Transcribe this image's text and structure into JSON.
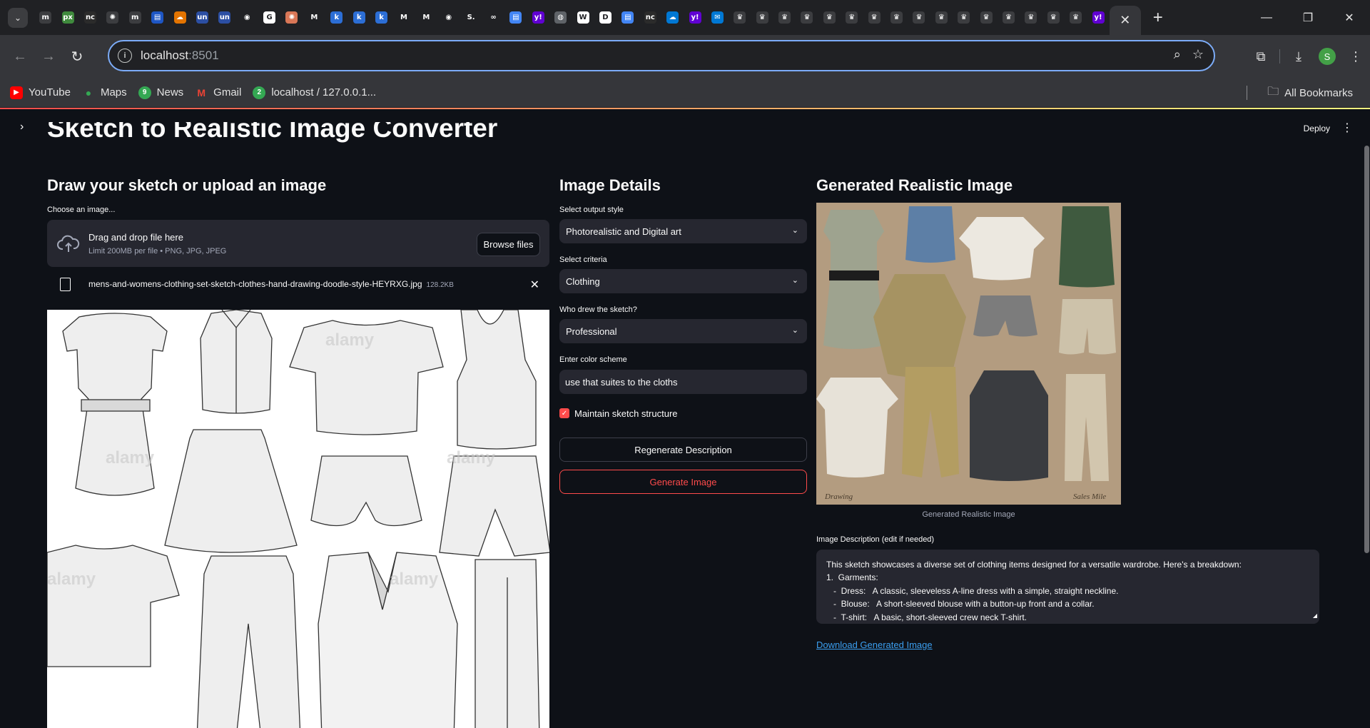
{
  "browser": {
    "active_tab_close": "✕",
    "new_tab": "+",
    "url_host": "localhost",
    "url_port": ":8501",
    "favicons": [
      {
        "t": "m",
        "bg": "#3c3d40"
      },
      {
        "t": "px",
        "bg": "#3f8a3d"
      },
      {
        "t": "nc",
        "bg": "#2b2b2b"
      },
      {
        "t": "✺",
        "bg": "#3c3d40"
      },
      {
        "t": "m",
        "bg": "#3c3d40"
      },
      {
        "t": "▤",
        "bg": "#1e56c4"
      },
      {
        "t": "☁",
        "bg": "#e37400"
      },
      {
        "t": "un",
        "bg": "#2c4fa3"
      },
      {
        "t": "un",
        "bg": "#2c4fa3"
      },
      {
        "t": "◉",
        "bg": "#202124"
      },
      {
        "t": "G",
        "bg": "#ffffff"
      },
      {
        "t": "✺",
        "bg": "#d97757"
      },
      {
        "t": "M",
        "bg": "#202124"
      },
      {
        "t": "k",
        "bg": "#2c6ed5"
      },
      {
        "t": "k",
        "bg": "#2c6ed5"
      },
      {
        "t": "k",
        "bg": "#2c6ed5"
      },
      {
        "t": "M",
        "bg": "#202124"
      },
      {
        "t": "M",
        "bg": "#202124"
      },
      {
        "t": "◉",
        "bg": "#202124"
      },
      {
        "t": "S.",
        "bg": "#202124"
      },
      {
        "t": "∞",
        "bg": "#202124"
      },
      {
        "t": "▤",
        "bg": "#4285f4"
      },
      {
        "t": "y!",
        "bg": "#6001d2"
      },
      {
        "t": "◍",
        "bg": "#5f6368"
      },
      {
        "t": "W",
        "bg": "#ffffff"
      },
      {
        "t": "D",
        "bg": "#ffffff"
      },
      {
        "t": "▤",
        "bg": "#4285f4"
      },
      {
        "t": "nc",
        "bg": "#2b2b2b"
      },
      {
        "t": "☁",
        "bg": "#0078d4"
      },
      {
        "t": "y!",
        "bg": "#6001d2"
      },
      {
        "t": "✉",
        "bg": "#0078d4"
      },
      {
        "t": "♛",
        "bg": "#3c3d40"
      },
      {
        "t": "♛",
        "bg": "#3c3d40"
      },
      {
        "t": "♛",
        "bg": "#3c3d40"
      },
      {
        "t": "♛",
        "bg": "#3c3d40"
      },
      {
        "t": "♛",
        "bg": "#3c3d40"
      },
      {
        "t": "♛",
        "bg": "#3c3d40"
      },
      {
        "t": "♛",
        "bg": "#3c3d40"
      },
      {
        "t": "♛",
        "bg": "#3c3d40"
      },
      {
        "t": "♛",
        "bg": "#3c3d40"
      },
      {
        "t": "♛",
        "bg": "#3c3d40"
      },
      {
        "t": "♛",
        "bg": "#3c3d40"
      },
      {
        "t": "♛",
        "bg": "#3c3d40"
      },
      {
        "t": "♛",
        "bg": "#3c3d40"
      },
      {
        "t": "♛",
        "bg": "#3c3d40"
      },
      {
        "t": "♛",
        "bg": "#3c3d40"
      },
      {
        "t": "♛",
        "bg": "#3c3d40"
      },
      {
        "t": "y!",
        "bg": "#6001d2"
      }
    ],
    "profile_initial": "S",
    "bookmarks": [
      {
        "label": "YouTube",
        "icon": "▶",
        "color": "#ff0000"
      },
      {
        "label": "Maps",
        "icon": "●",
        "color": "#34a853"
      },
      {
        "label": "News",
        "icon": "9",
        "color": "#34a853"
      },
      {
        "label": "Gmail",
        "icon": "M",
        "color": "#ea4335"
      },
      {
        "label": "localhost / 127.0.0.1...",
        "icon": "2",
        "color": "#34a853"
      }
    ],
    "all_bookmarks": "All Bookmarks"
  },
  "app": {
    "header": {
      "deploy": "Deploy"
    },
    "title": "Sketch to Realistic Image Converter",
    "col1": {
      "heading": "Draw your sketch or upload an image",
      "uploader_label": "Choose an image...",
      "drop_text": "Drag and drop file here",
      "limit_text": "Limit 200MB per file • PNG, JPG, JPEG",
      "browse_label": "Browse files",
      "file_name": "mens-and-womens-clothing-set-sketch-clothes-hand-drawing-doodle-style-HEYRXG.jpg",
      "file_size": "128.2KB",
      "watermark": "alamy"
    },
    "col2": {
      "heading": "Image Details",
      "style_label": "Select output style",
      "style_value": "Photorealistic and Digital art",
      "criteria_label": "Select criteria",
      "criteria_value": "Clothing",
      "drawer_label": "Who drew the sketch?",
      "drawer_value": "Professional",
      "color_label": "Enter color scheme",
      "color_value": "use that suites to the cloths",
      "checkbox_label": "Maintain sketch structure",
      "checkbox_checked": true,
      "regenerate_label": "Regenerate Description",
      "generate_label": "Generate Image"
    },
    "col3": {
      "heading": "Generated Realistic Image",
      "caption": "Generated Realistic Image",
      "signature_left": "Drawing",
      "signature_right": "Sales Mile",
      "desc_label": "Image Description (edit if needed)",
      "desc_lines": [
        "This sketch showcases a diverse set of clothing items designed for a versatile wardrobe. Here's a breakdown:",
        "",
        "1.  Garments:",
        "   -  Dress:   A classic, sleeveless A-line dress with a simple, straight neckline.",
        "   -  Blouse:   A short-sleeved blouse with a button-up front and a collar.",
        "   -  T-shirt:   A basic, short-sleeved crew neck T-shirt."
      ],
      "download_label": "Download Generated Image"
    }
  }
}
